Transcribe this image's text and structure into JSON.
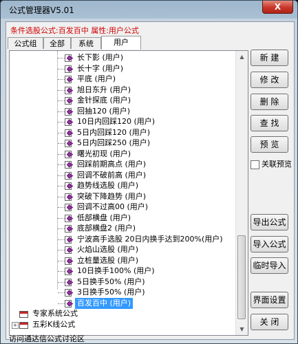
{
  "window": {
    "title": "公式管理器V5.01",
    "close_label": "X"
  },
  "condition_text": "条件选股公式:百发百中  属性:用户公式",
  "tabs": [
    {
      "label": "公式组"
    },
    {
      "label": "全部"
    },
    {
      "label": "系统"
    },
    {
      "label": "用户"
    }
  ],
  "tree": {
    "items": [
      {
        "label": "长下影  (用户)"
      },
      {
        "label": "长十字  (用户)"
      },
      {
        "label": "平底  (用户)"
      },
      {
        "label": "旭日东升  (用户)"
      },
      {
        "label": "金针探底  (用户)"
      },
      {
        "label": "回抽120  (用户)"
      },
      {
        "label": "10日内回踩120  (用户)"
      },
      {
        "label": "5日内回踩120  (用户)"
      },
      {
        "label": "5日内回踩250  (用户)"
      },
      {
        "label": "曙光初现  (用户)"
      },
      {
        "label": "回踩前期高点  (用户)"
      },
      {
        "label": "回调不破前高  (用户)"
      },
      {
        "label": "趋势线选股  (用户)"
      },
      {
        "label": "突破下降趋势  (用户)"
      },
      {
        "label": "回调不过高00  (用户)"
      },
      {
        "label": "低部横盘  (用户)"
      },
      {
        "label": "底部横盘2  (用户)"
      },
      {
        "label": "宁波高手选股  20日内换手达到200%(用户)"
      },
      {
        "label": "火焰山选股  (用户)"
      },
      {
        "label": "立桩量选股  (用户)"
      },
      {
        "label": "10日换手100%  (用户)"
      },
      {
        "label": "5日换手50%  (用户)"
      },
      {
        "label": "3日换手50%  (用户)"
      },
      {
        "label": "百发百中  (用户)",
        "selected": true
      }
    ],
    "groups": [
      {
        "label": "专家系统公式"
      },
      {
        "label": "五彩K线公式"
      }
    ]
  },
  "buttons": {
    "new": "新 建",
    "edit": "修 改",
    "delete": "删 除",
    "find": "查 找",
    "preview": "预 览",
    "export": "导出公式",
    "import": "导入公式",
    "temp_import": "临时导入",
    "ui_settings": "界面设置",
    "close": "关 闭"
  },
  "link_preview_label": "关联预览",
  "status_text": "访问通达信公式讨论区",
  "colors": {
    "accent_red": "#d00000",
    "selection": "#3399ff",
    "formula_icon": "#9b2fa8"
  }
}
